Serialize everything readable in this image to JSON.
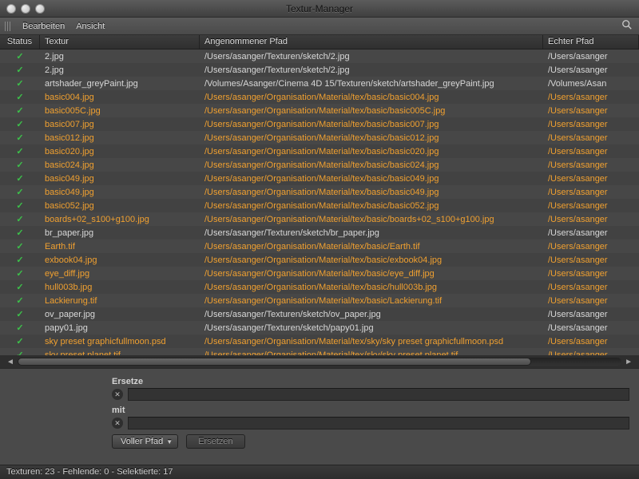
{
  "window": {
    "title": "Textur-Manager"
  },
  "menu": {
    "items": [
      "Bearbeiten",
      "Ansicht"
    ]
  },
  "columns": {
    "status": "Status",
    "textur": "Textur",
    "pfad": "Angenommener Pfad",
    "echt": "Echter Pfad"
  },
  "rows": [
    {
      "sel": false,
      "textur": "2.jpg",
      "pfad": "/Users/asanger/Texturen/sketch/2.jpg",
      "echt": "/Users/asanger"
    },
    {
      "sel": false,
      "textur": "2.jpg",
      "pfad": "/Users/asanger/Texturen/sketch/2.jpg",
      "echt": "/Users/asanger"
    },
    {
      "sel": false,
      "textur": "artshader_greyPaint.jpg",
      "pfad": "/Volumes/Asanger/Cinema 4D 15/Texturen/sketch/artshader_greyPaint.jpg",
      "echt": "/Volumes/Asan"
    },
    {
      "sel": true,
      "textur": "basic004.jpg",
      "pfad": "/Users/asanger/Organisation/Material/tex/basic/basic004.jpg",
      "echt": "/Users/asanger"
    },
    {
      "sel": true,
      "textur": "basic005C.jpg",
      "pfad": "/Users/asanger/Organisation/Material/tex/basic/basic005C.jpg",
      "echt": "/Users/asanger"
    },
    {
      "sel": true,
      "textur": "basic007.jpg",
      "pfad": "/Users/asanger/Organisation/Material/tex/basic/basic007.jpg",
      "echt": "/Users/asanger"
    },
    {
      "sel": true,
      "textur": "basic012.jpg",
      "pfad": "/Users/asanger/Organisation/Material/tex/basic/basic012.jpg",
      "echt": "/Users/asanger"
    },
    {
      "sel": true,
      "textur": "basic020.jpg",
      "pfad": "/Users/asanger/Organisation/Material/tex/basic/basic020.jpg",
      "echt": "/Users/asanger"
    },
    {
      "sel": true,
      "textur": "basic024.jpg",
      "pfad": "/Users/asanger/Organisation/Material/tex/basic/basic024.jpg",
      "echt": "/Users/asanger"
    },
    {
      "sel": true,
      "textur": "basic049.jpg",
      "pfad": "/Users/asanger/Organisation/Material/tex/basic/basic049.jpg",
      "echt": "/Users/asanger"
    },
    {
      "sel": true,
      "textur": "basic049.jpg",
      "pfad": "/Users/asanger/Organisation/Material/tex/basic/basic049.jpg",
      "echt": "/Users/asanger"
    },
    {
      "sel": true,
      "textur": "basic052.jpg",
      "pfad": "/Users/asanger/Organisation/Material/tex/basic/basic052.jpg",
      "echt": "/Users/asanger"
    },
    {
      "sel": true,
      "textur": "boards+02_s100+g100.jpg",
      "pfad": "/Users/asanger/Organisation/Material/tex/basic/boards+02_s100+g100.jpg",
      "echt": "/Users/asanger"
    },
    {
      "sel": false,
      "textur": "br_paper.jpg",
      "pfad": "/Users/asanger/Texturen/sketch/br_paper.jpg",
      "echt": "/Users/asanger"
    },
    {
      "sel": true,
      "textur": "Earth.tif",
      "pfad": "/Users/asanger/Organisation/Material/tex/basic/Earth.tif",
      "echt": "/Users/asanger"
    },
    {
      "sel": true,
      "textur": "exbook04.jpg",
      "pfad": "/Users/asanger/Organisation/Material/tex/basic/exbook04.jpg",
      "echt": "/Users/asanger"
    },
    {
      "sel": true,
      "textur": "eye_diff.jpg",
      "pfad": "/Users/asanger/Organisation/Material/tex/basic/eye_diff.jpg",
      "echt": "/Users/asanger"
    },
    {
      "sel": true,
      "textur": "hull003b.jpg",
      "pfad": "/Users/asanger/Organisation/Material/tex/basic/hull003b.jpg",
      "echt": "/Users/asanger"
    },
    {
      "sel": true,
      "textur": "Lackierung.tif",
      "pfad": "/Users/asanger/Organisation/Material/tex/basic/Lackierung.tif",
      "echt": "/Users/asanger"
    },
    {
      "sel": false,
      "textur": "ov_paper.jpg",
      "pfad": "/Users/asanger/Texturen/sketch/ov_paper.jpg",
      "echt": "/Users/asanger"
    },
    {
      "sel": false,
      "textur": "papy01.jpg",
      "pfad": "/Users/asanger/Texturen/sketch/papy01.jpg",
      "echt": "/Users/asanger"
    },
    {
      "sel": true,
      "textur": "sky preset graphicfullmoon.psd",
      "pfad": "/Users/asanger/Organisation/Material/tex/sky/sky preset graphicfullmoon.psd",
      "echt": "/Users/asanger"
    },
    {
      "sel": true,
      "textur": "sky preset planet.tif",
      "pfad": "/Users/asanger/Organisation/Material/tex/sky/sky preset planet.tif",
      "echt": "/Users/asanger"
    }
  ],
  "form": {
    "ersetze_label": "Ersetze",
    "mit_label": "mit",
    "ersetze_value": "",
    "mit_value": "",
    "dropdown_label": "Voller Pfad",
    "button_label": "Ersetzen"
  },
  "status": "Texturen: 23 - Fehlende: 0 - Selektierte: 17"
}
